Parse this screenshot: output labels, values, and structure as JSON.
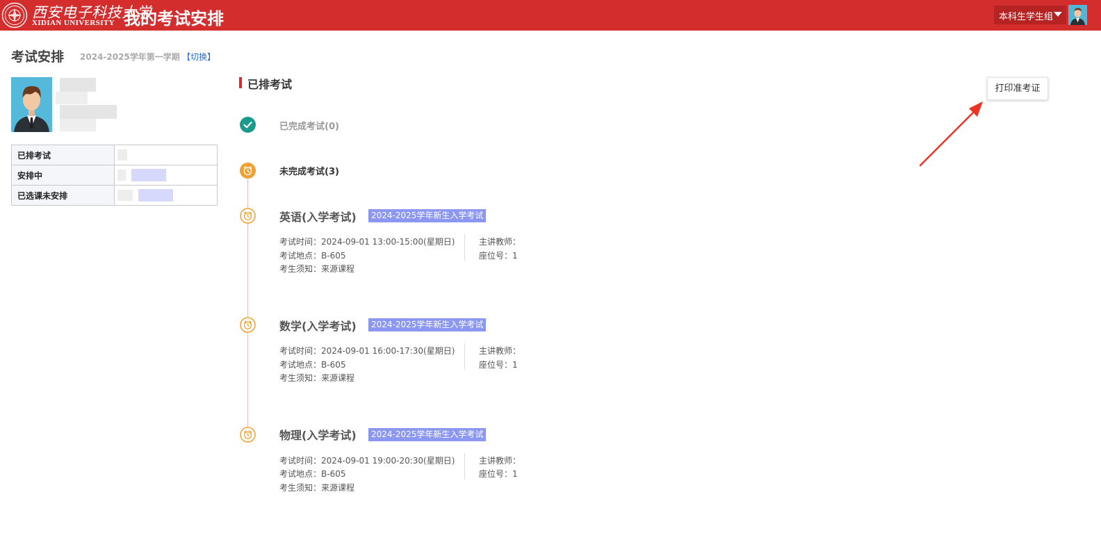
{
  "header": {
    "logo_cn": "西安电子科技大学",
    "logo_en": "XIDIAN UNIVERSITY",
    "app_title": "我的考试安排",
    "role": "本科生学生组"
  },
  "page": {
    "title": "考试安排",
    "semester": "2024-2025学年第一学期",
    "switch_label": "【切换】"
  },
  "stats": [
    {
      "label": "已排考试"
    },
    {
      "label": "安排中"
    },
    {
      "label": "已选课未安排"
    }
  ],
  "section": {
    "title": "已排考试",
    "print_button": "打印准考证"
  },
  "timeline": {
    "completed_label": "已完成考试(0)",
    "pending_label": "未完成考试(3)"
  },
  "exams": [
    {
      "name": "英语(入学考试)",
      "tag": "2024-2025学年新生入学考试",
      "time": "考试时间：2024-09-01 13:00-15:00(星期日)",
      "location": "考试地点：B-605",
      "notice": "考生须知：来源课程",
      "teacher": "主讲教师：",
      "seat": "座位号：1"
    },
    {
      "name": "数学(入学考试)",
      "tag": "2024-2025学年新生入学考试",
      "time": "考试时间：2024-09-01 16:00-17:30(星期日)",
      "location": "考试地点：B-605",
      "notice": "考生须知：来源课程",
      "teacher": "主讲教师：",
      "seat": "座位号：1"
    },
    {
      "name": "物理(入学考试)",
      "tag": "2024-2025学年新生入学考试",
      "time": "考试时间：2024-09-01 19:00-20:30(星期日)",
      "location": "考试地点：B-605",
      "notice": "考生须知：来源课程",
      "teacher": "主讲教师：",
      "seat": "座位号：1"
    }
  ],
  "colors": {
    "brand_red": "#d42d2d",
    "tag_purple": "#8b97f2",
    "done_teal": "#1a9a8a",
    "pending_orange": "#f0a030"
  }
}
